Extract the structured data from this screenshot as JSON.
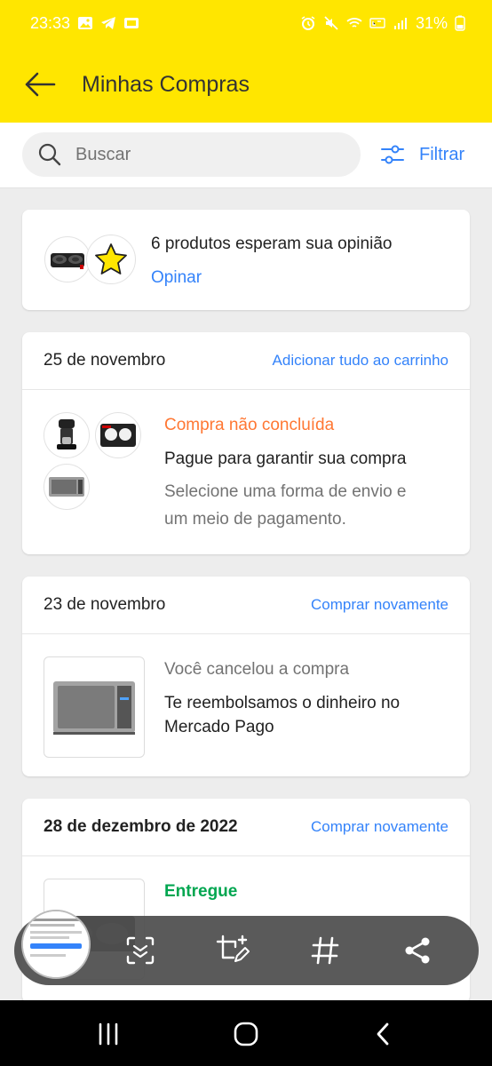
{
  "status_bar": {
    "time": "23:33",
    "battery": "31%",
    "icons_left": [
      "gallery-icon",
      "telegram-icon",
      "app-notification-icon"
    ],
    "icons_right": [
      "alarm-icon",
      "mute-icon",
      "wifi-icon",
      "volte-icon",
      "signal-icon",
      "battery-icon"
    ]
  },
  "header": {
    "title": "Minhas Compras",
    "back_icon": "arrow-left-icon",
    "bg_color": "#ffe600"
  },
  "search": {
    "placeholder": "Buscar",
    "filter_label": "Filtrar"
  },
  "review_card": {
    "text": "6 produtos esperam sua opinião",
    "action": "Opinar"
  },
  "orders": [
    {
      "date": "25 de novembro",
      "action": "Adicionar tudo ao carrinho",
      "status": "Compra não concluída",
      "status_color": "#f73",
      "message": "Pague para garantir sua compra",
      "detail_line1": "Selecione uma forma de envio e",
      "detail_line2": "um meio de pagamento."
    },
    {
      "date": "23 de novembro",
      "action": "Comprar novamente",
      "status": "Você cancelou a compra",
      "message_line1": "Te reembolsamos o dinheiro no",
      "message_line2": "Mercado Pago"
    },
    {
      "date": "28 de dezembro de 2022",
      "action": "Comprar novamente",
      "status": "Entregue",
      "status_color": "#00a650"
    }
  ],
  "accent_color": "#3483fa",
  "toolbar": {
    "buttons": [
      "scan-icon",
      "crop-edit-icon",
      "hashtag-icon",
      "share-icon"
    ]
  },
  "nav": {
    "buttons": [
      "recents-icon",
      "home-icon",
      "back-icon"
    ]
  }
}
